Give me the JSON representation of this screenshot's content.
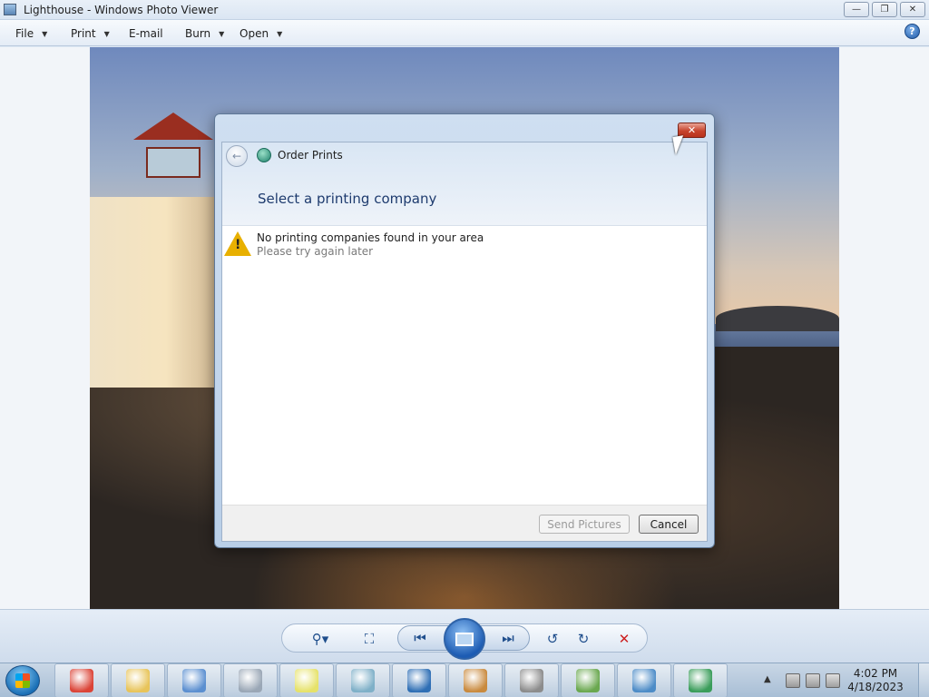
{
  "window": {
    "title": "Lighthouse - Windows Photo Viewer",
    "minimize_symbol": "—",
    "restore_symbol": "❐",
    "close_symbol": "✕"
  },
  "menu": {
    "file": "File",
    "print": "Print",
    "email": "E-mail",
    "burn": "Burn",
    "open": "Open",
    "help_symbol": "?"
  },
  "dialog": {
    "app_title": "Order Prints",
    "heading": "Select a printing company",
    "message": "No printing companies found in your area",
    "submessage": "Please try again later",
    "send_button": "Send Pictures",
    "cancel_button": "Cancel",
    "close_symbol": "✕",
    "warn_symbol": "!",
    "back_symbol": "←"
  },
  "controls": {
    "zoom_symbol": "⚲▾",
    "fit_symbol": "⛶",
    "prev_symbol": "⏮",
    "next_symbol": "⏭",
    "rotate_ccw_symbol": "↺",
    "rotate_cw_symbol": "↻",
    "delete_symbol": "✕"
  },
  "taskbar": {
    "items": [
      {
        "name": "chrome-icon",
        "color": "#db4437"
      },
      {
        "name": "folder-icon",
        "color": "#e8c45a"
      },
      {
        "name": "control-panel-icon",
        "color": "#5b8fd0"
      },
      {
        "name": "calculator-icon",
        "color": "#9aa7b6"
      },
      {
        "name": "sticky-notes-icon",
        "color": "#e6e26a"
      },
      {
        "name": "document-icon",
        "color": "#7fb0c8"
      },
      {
        "name": "remote-desktop-icon",
        "color": "#2f6fb5"
      },
      {
        "name": "paint-icon",
        "color": "#c98a3e"
      },
      {
        "name": "fax-icon",
        "color": "#8c8c8c"
      },
      {
        "name": "notepad-icon",
        "color": "#6aa84f"
      },
      {
        "name": "photo-viewer-icon",
        "color": "#4d8cc7"
      },
      {
        "name": "network-icon",
        "color": "#3a9d5a"
      }
    ],
    "time": "4:02 PM",
    "date": "4/18/2023",
    "tray_arrow": "▲"
  },
  "colors": {
    "accent": "#1f4e8c",
    "close_red": "#c7432c",
    "delete_red": "#cc1f1f",
    "warning_yellow": "#e8b000"
  }
}
